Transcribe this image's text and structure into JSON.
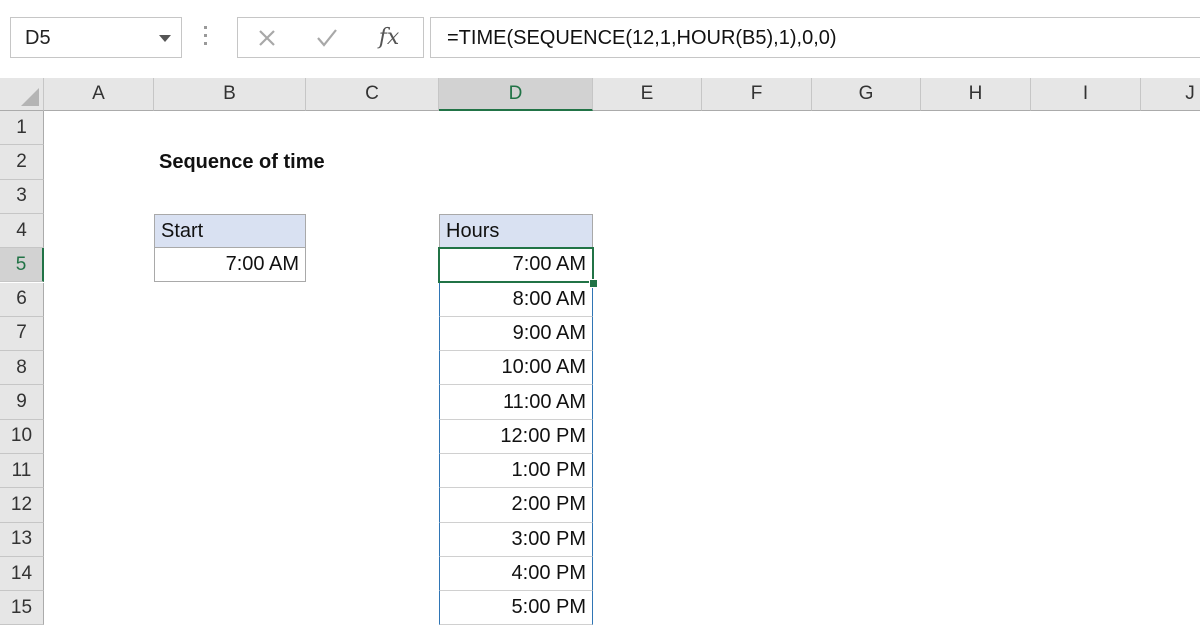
{
  "formula_bar": {
    "name_box": "D5",
    "formula": "=TIME(SEQUENCE(12,1,HOUR(B5),1),0,0)",
    "fx_label": "fx"
  },
  "grid": {
    "columns": [
      "A",
      "B",
      "C",
      "D",
      "E",
      "F",
      "G",
      "H",
      "I",
      "J"
    ],
    "rows": [
      "1",
      "2",
      "3",
      "4",
      "5",
      "6",
      "7",
      "8",
      "9",
      "10",
      "11",
      "12",
      "13",
      "14",
      "15"
    ],
    "active_column": "D",
    "active_row": "5",
    "active_color": "#217346",
    "header_fill": "#d9e1f2",
    "spill_border_color": "#2f75b5"
  },
  "sheet": {
    "title": "Sequence of time",
    "start_header": "Start",
    "start_value": "7:00 AM",
    "hours_header": "Hours",
    "hours": [
      "7:00 AM",
      "8:00 AM",
      "9:00 AM",
      "10:00 AM",
      "11:00 AM",
      "12:00 PM",
      "1:00 PM",
      "2:00 PM",
      "3:00 PM",
      "4:00 PM",
      "5:00 PM"
    ]
  }
}
